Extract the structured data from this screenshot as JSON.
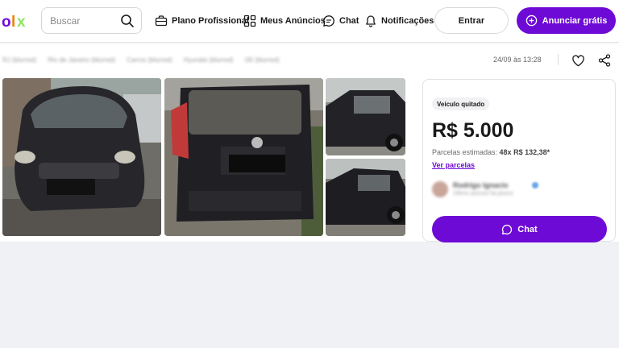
{
  "header": {
    "logo": {
      "letters": [
        "o",
        "l",
        "x"
      ],
      "colors": [
        "#6e0ad6",
        "#f28000",
        "#8ce563"
      ]
    },
    "search": {
      "placeholder": "Buscar",
      "value": ""
    },
    "nav": [
      {
        "label": "Plano Profissional",
        "icon": "briefcase-icon"
      },
      {
        "label": "Meus Anúncios",
        "icon": "grid-icon"
      },
      {
        "label": "Chat",
        "icon": "chat-bubble-icon"
      },
      {
        "label": "Notificações",
        "icon": "bell-icon"
      }
    ],
    "login_label": "Entrar",
    "post_ad_label": "Anunciar grátis"
  },
  "listing": {
    "breadcrumb": [
      "RJ (blurred)",
      "Rio de Janeiro (blurred)",
      "Carros (blurred)",
      "Hyundai (blurred)",
      "i30 (blurred)"
    ],
    "posted_at": "24/09 às 13:28",
    "photos": [
      {
        "icon": "car-front-photo"
      },
      {
        "icon": "car-rear-photo"
      },
      {
        "icon": "car-side-photo"
      },
      {
        "icon": "car-side-photo-2"
      }
    ]
  },
  "card": {
    "badge": "Veículo quitado",
    "price": "R$ 5.000",
    "installments_prefix": "Parcelas estimadas: ",
    "installments_value": "48x R$ 132,38*",
    "see_installments": "Ver parcelas",
    "seller_name": "Rodrigo Ignacio",
    "seller_sub": "Último acesso há pouco",
    "chat_label": "Chat"
  },
  "colors": {
    "brand_purple": "#6e0ad6",
    "page_bg": "#f0f1f4"
  }
}
